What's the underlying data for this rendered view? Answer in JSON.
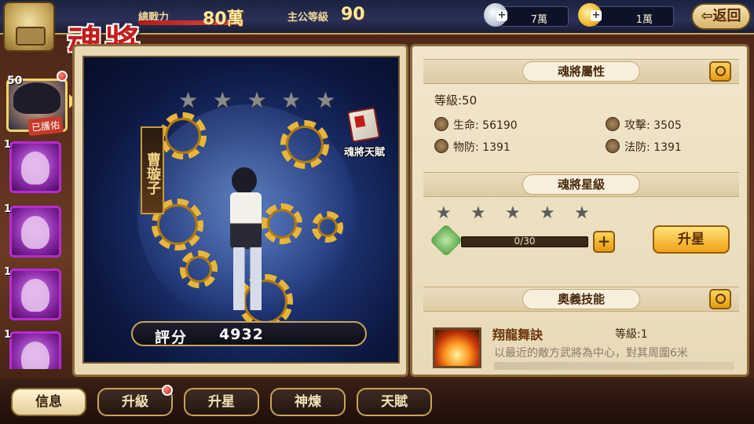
{
  "header": {
    "title": "魂將",
    "power_label": "總戰力",
    "power_value": "80萬",
    "level_label": "主公等級",
    "level_value": "90",
    "silver_amount": "7萬",
    "gold_amount": "1萬",
    "back_label": "返回"
  },
  "hero_list": {
    "selected": {
      "level": "50",
      "tag": "已護佑"
    },
    "others": [
      {
        "level": "1"
      },
      {
        "level": "1"
      },
      {
        "level": "1"
      },
      {
        "level": "1"
      }
    ]
  },
  "hero_view": {
    "stars_total": 5,
    "stars_filled": 0,
    "name": "曹璇子",
    "talent_label": "魂將天賦",
    "score_label": "評分",
    "score_value": "4932"
  },
  "attributes": {
    "section_title": "魂將屬性",
    "level": "等級:50",
    "hp_label": "生命:",
    "hp_value": "56190",
    "atk_label": "攻擊:",
    "atk_value": "3505",
    "pdef_label": "物防:",
    "pdef_value": "1391",
    "mdef_label": "法防:",
    "mdef_value": "1391"
  },
  "star_level": {
    "section_title": "魂將星級",
    "progress_text": "0/30",
    "progress_fraction": 0,
    "upgrade_label": "升星"
  },
  "skill": {
    "section_title": "奧義技能",
    "name": "翔龍舞訣",
    "level": "等級:1",
    "description": "以最近的敵方武將為中心，對其周圍6米"
  },
  "tabs": [
    "信息",
    "升級",
    "升星",
    "神煉",
    "天賦"
  ],
  "colors": {
    "accent_gold": "#c9a457",
    "title_red": "#c21d1d",
    "badge_red": "#d11a1a"
  }
}
